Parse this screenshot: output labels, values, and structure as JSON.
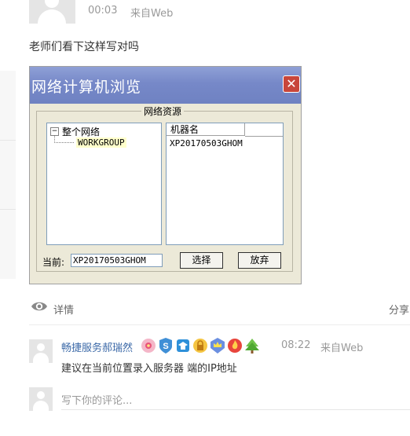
{
  "post": {
    "time": "00:03",
    "source": "来自Web",
    "text": "老师们看下这样写对吗"
  },
  "dialog": {
    "title": "网络计算机浏览",
    "close_glyph": "✕",
    "group_label": "网络资源",
    "tree": {
      "expander": "−",
      "root": "整个网络",
      "child": "WORKGROUP"
    },
    "list": {
      "header": "机器名",
      "items": [
        "XP20170503GHOM"
      ]
    },
    "current_label": "当前:",
    "current_value": "XP20170503GHOM",
    "select_button": "选择",
    "cancel_button": "放弃"
  },
  "actions": {
    "detail_label": "详情",
    "share_label": "分享"
  },
  "comment": {
    "user": "畅捷服务郝瑞然",
    "badges": [
      "flower-badge",
      "s-badge",
      "hat-badge",
      "lock-badge",
      "crown-badge",
      "fire-badge",
      "tree-badge"
    ],
    "time": "08:22",
    "source": "来自Web",
    "text": "建议在当前位置录入服务器 端的IP地址"
  },
  "comment_input": {
    "placeholder": "写下你的评论..."
  }
}
